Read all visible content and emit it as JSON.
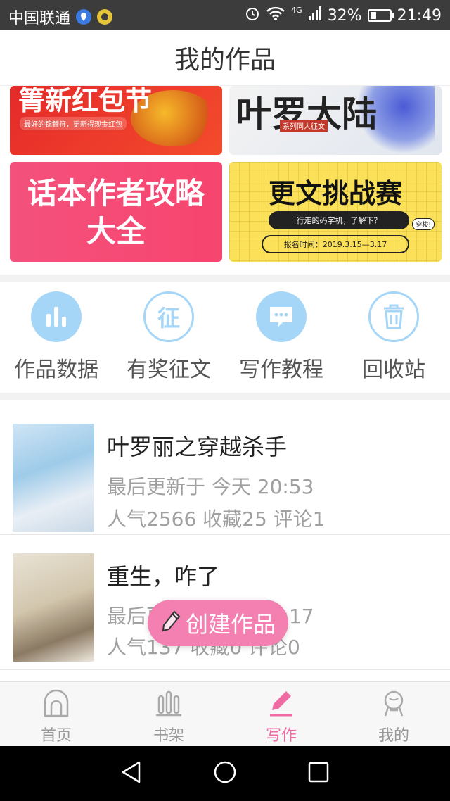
{
  "status_bar": {
    "carrier": "中国联通",
    "network": "4G",
    "battery": "32%",
    "battery_level": 0.32,
    "time": "21:49"
  },
  "header": {
    "title": "我的作品"
  },
  "banners": {
    "b1": {
      "title": "箐新红包节",
      "sub": "最好的锦鲤符，更新得现金红包"
    },
    "b2": {
      "title": "叶罗大陆",
      "sub": "系列同人征文"
    },
    "b3": {
      "title_line1": "话本作者攻略",
      "title_line2": "大全"
    },
    "b4": {
      "title": "更文挑战赛",
      "pill": "行走的码字机，了解下？",
      "date": "报名时间：2019.3.15—3.17",
      "tag": "穿梭!"
    }
  },
  "quick_menu": [
    {
      "label": "作品数据",
      "icon": "bar-chart-icon"
    },
    {
      "label": "有奖征文",
      "icon": "contest-icon",
      "glyph": "征"
    },
    {
      "label": "写作教程",
      "icon": "chat-bubble-icon"
    },
    {
      "label": "回收站",
      "icon": "trash-icon"
    }
  ],
  "works": [
    {
      "title": "叶罗丽之穿越杀手",
      "updated": "最后更新于 今天 20:53",
      "stats": "人气2566 收藏25 评论1"
    },
    {
      "title": "重生，咋了",
      "updated": "最后更新于 今天 20:17",
      "stats": "人气137 收藏0 评论0"
    }
  ],
  "fab": {
    "label": "创建作品",
    "icon": "pencil-icon"
  },
  "tabs": [
    {
      "label": "首页",
      "icon": "home-icon",
      "active": false
    },
    {
      "label": "书架",
      "icon": "bookshelf-icon",
      "active": false
    },
    {
      "label": "写作",
      "icon": "pen-icon",
      "active": true
    },
    {
      "label": "我的",
      "icon": "profile-icon",
      "active": false
    }
  ],
  "colors": {
    "accent": "#f06aa4",
    "quick_icon": "#a6d6f7",
    "fab": "#f47fb1"
  }
}
